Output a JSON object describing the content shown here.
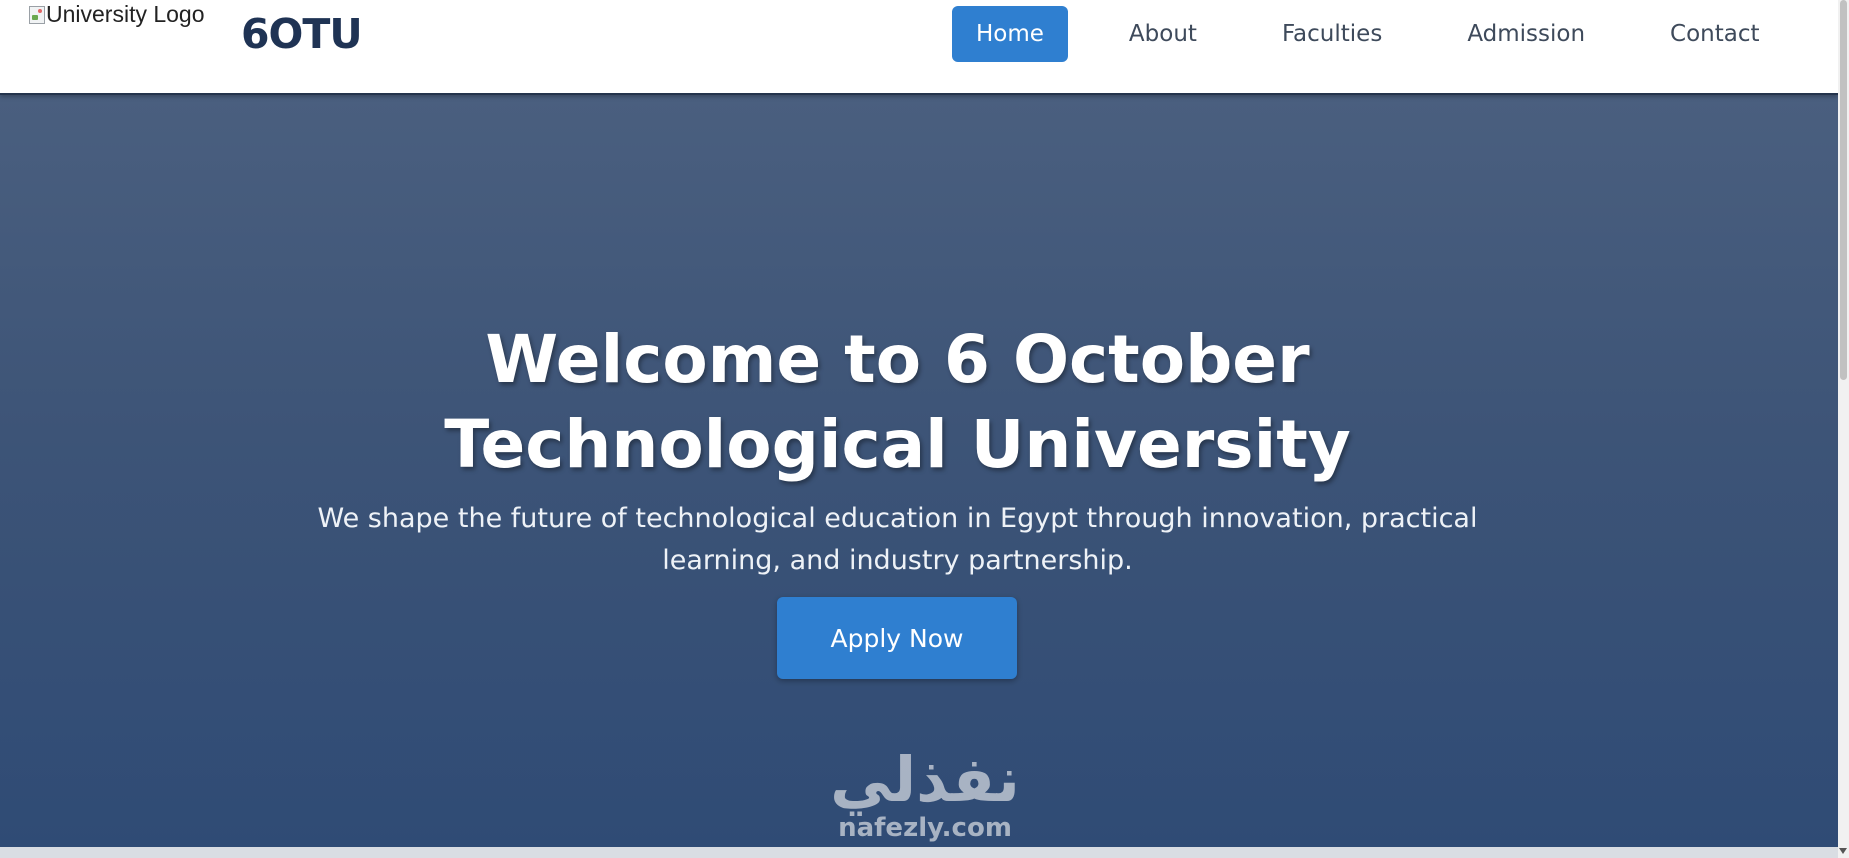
{
  "header": {
    "logo_alt": "University Logo",
    "brand": "6OTU",
    "nav": [
      {
        "label": "Home",
        "active": true
      },
      {
        "label": "About",
        "active": false
      },
      {
        "label": "Faculties",
        "active": false
      },
      {
        "label": "Admission",
        "active": false
      },
      {
        "label": "Contact",
        "active": false
      }
    ]
  },
  "hero": {
    "title_line1": "Welcome to 6 October",
    "title_line2": "Technological University",
    "subtitle": "We shape the future of technological education in Egypt through innovation, practical learning, and industry partnership.",
    "cta_label": "Apply Now"
  },
  "watermark": {
    "arabic": "نفذلي",
    "latin": "nafezly.com"
  },
  "colors": {
    "accent": "#2f7fd0",
    "brand": "#1f3354",
    "hero_top": "#4a5f7f",
    "hero_bottom": "#2f4b75"
  }
}
